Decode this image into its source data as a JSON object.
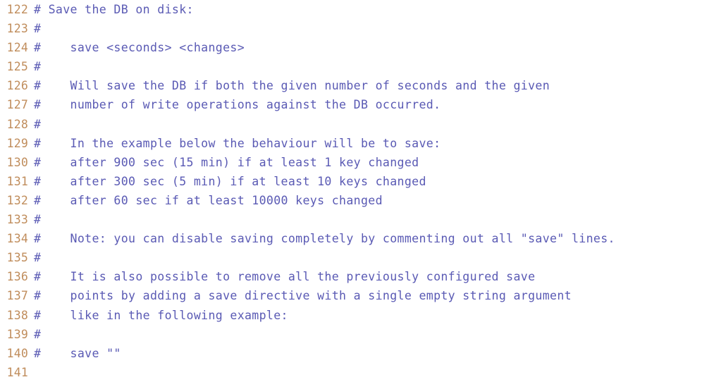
{
  "editor": {
    "name": "code-viewer",
    "language": "redis-conf",
    "background_color": "#ffffff",
    "line_number_color": "#c08d5c",
    "code_text_color": "#5a5ab4",
    "first_line_number": 122,
    "last_line_number": 141,
    "total_lines": 20
  },
  "lines": [
    {
      "number": "122",
      "text": "# Save the DB on disk:"
    },
    {
      "number": "123",
      "text": "#"
    },
    {
      "number": "124",
      "text": "#    save <seconds> <changes>"
    },
    {
      "number": "125",
      "text": "#"
    },
    {
      "number": "126",
      "text": "#    Will save the DB if both the given number of seconds and the given"
    },
    {
      "number": "127",
      "text": "#    number of write operations against the DB occurred."
    },
    {
      "number": "128",
      "text": "#"
    },
    {
      "number": "129",
      "text": "#    In the example below the behaviour will be to save:"
    },
    {
      "number": "130",
      "text": "#    after 900 sec (15 min) if at least 1 key changed"
    },
    {
      "number": "131",
      "text": "#    after 300 sec (5 min) if at least 10 keys changed"
    },
    {
      "number": "132",
      "text": "#    after 60 sec if at least 10000 keys changed"
    },
    {
      "number": "133",
      "text": "#"
    },
    {
      "number": "134",
      "text": "#    Note: you can disable saving completely by commenting out all \"save\" lines."
    },
    {
      "number": "135",
      "text": "#"
    },
    {
      "number": "136",
      "text": "#    It is also possible to remove all the previously configured save"
    },
    {
      "number": "137",
      "text": "#    points by adding a save directive with a single empty string argument"
    },
    {
      "number": "138",
      "text": "#    like in the following example:"
    },
    {
      "number": "139",
      "text": "#"
    },
    {
      "number": "140",
      "text": "#    save \"\""
    },
    {
      "number": "141",
      "text": ""
    }
  ]
}
